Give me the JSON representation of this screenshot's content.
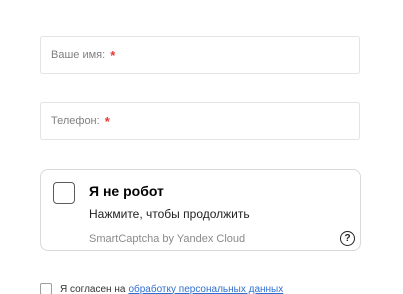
{
  "form": {
    "name_field": {
      "placeholder": "Ваше имя:",
      "required_mark": "*"
    },
    "phone_field": {
      "placeholder": "Телефон:",
      "required_mark": "*"
    },
    "captcha": {
      "title": "Я не робот",
      "subtitle": "Нажмите, чтобы продолжить",
      "brand": "SmartCaptcha by Yandex Cloud",
      "help_icon": "question-circle-icon",
      "help_glyph": "?"
    },
    "consent": {
      "label": "Я согласен на",
      "link_text": "обработку персональных данных"
    }
  },
  "colors": {
    "required": "#e53935",
    "link": "#2f6fd0",
    "border": "#e3e3e3",
    "placeholder_text": "#808080"
  }
}
